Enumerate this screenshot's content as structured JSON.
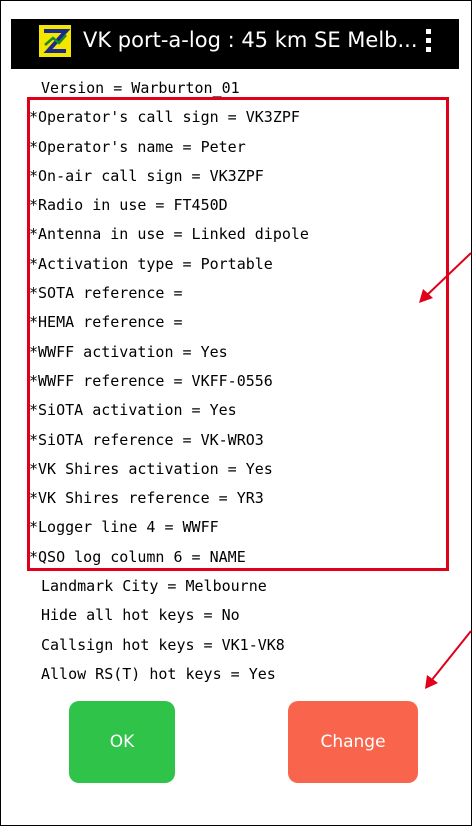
{
  "appbar": {
    "title": "VK port-a-log : 45 km SE Melb...",
    "icon": "vk-port-a-log-logo"
  },
  "settings": [
    "Version = Warburton_01",
    "*Operator's call sign = VK3ZPF",
    "*Operator's name = Peter",
    "*On-air call sign = VK3ZPF",
    "*Radio in use = FT450D",
    "*Antenna in use = Linked dipole",
    "*Activation type = Portable",
    "*SOTA reference =",
    "*HEMA reference =",
    "*WWFF activation = Yes",
    "*WWFF reference = VKFF-0556",
    "*SiOTA activation = Yes",
    "*SiOTA reference = VK-WRO3",
    "*VK Shires activation = Yes",
    "*VK Shires reference = YR3",
    "*Logger line 4 = WWFF",
    "*QSO log column 6 = NAME",
    "Landmark City = Melbourne",
    "Hide all hot keys = No",
    "Callsign hot keys = VK1-VK8",
    "Allow RS(T) hot keys = Yes"
  ],
  "buttons": {
    "ok": "OK",
    "change": "Change"
  },
  "colors": {
    "annotation": "#e0001a",
    "ok": "#2fc34a",
    "change": "#f9654c"
  }
}
